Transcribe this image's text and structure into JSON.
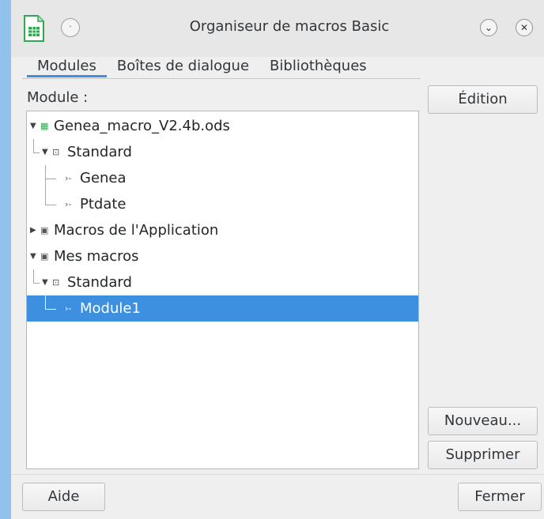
{
  "window": {
    "title": "Organiseur de macros Basic",
    "menu_glyph": "·",
    "minimize_glyph": "⌄",
    "close_glyph": "✕"
  },
  "tabs": [
    {
      "label": "Modules",
      "active": true
    },
    {
      "label": "Boîtes de dialogue",
      "active": false
    },
    {
      "label": "Bibliothèques",
      "active": false
    }
  ],
  "module_label": "Module :",
  "tree": [
    {
      "label": "Genea_macro_V2.4b.ods",
      "level": 0,
      "expanded": true,
      "icon": "spreadsheet-icon",
      "selected": false
    },
    {
      "label": "Standard",
      "level": 1,
      "expanded": true,
      "icon": "library-icon",
      "selected": false
    },
    {
      "label": "Genea",
      "level": 2,
      "icon": "module-icon",
      "selected": false
    },
    {
      "label": "Ptdate",
      "level": 2,
      "icon": "module-icon",
      "selected": false
    },
    {
      "label": "Macros de l'Application",
      "level": 0,
      "expanded": false,
      "icon": "application-icon",
      "selected": false
    },
    {
      "label": "Mes macros",
      "level": 0,
      "expanded": true,
      "icon": "user-macros-icon",
      "selected": false
    },
    {
      "label": "Standard",
      "level": 1,
      "expanded": true,
      "icon": "library-icon",
      "selected": false
    },
    {
      "label": "Module1",
      "level": 2,
      "icon": "module-icon",
      "selected": true
    }
  ],
  "buttons": {
    "edit": "Édition",
    "new": "Nouveau...",
    "delete": "Supprimer",
    "help": "Aide",
    "close": "Fermer"
  },
  "colors": {
    "selection": "#3d8fe0",
    "accent_tab": "#3d8fe0",
    "app_icon": "#2fa84f"
  }
}
